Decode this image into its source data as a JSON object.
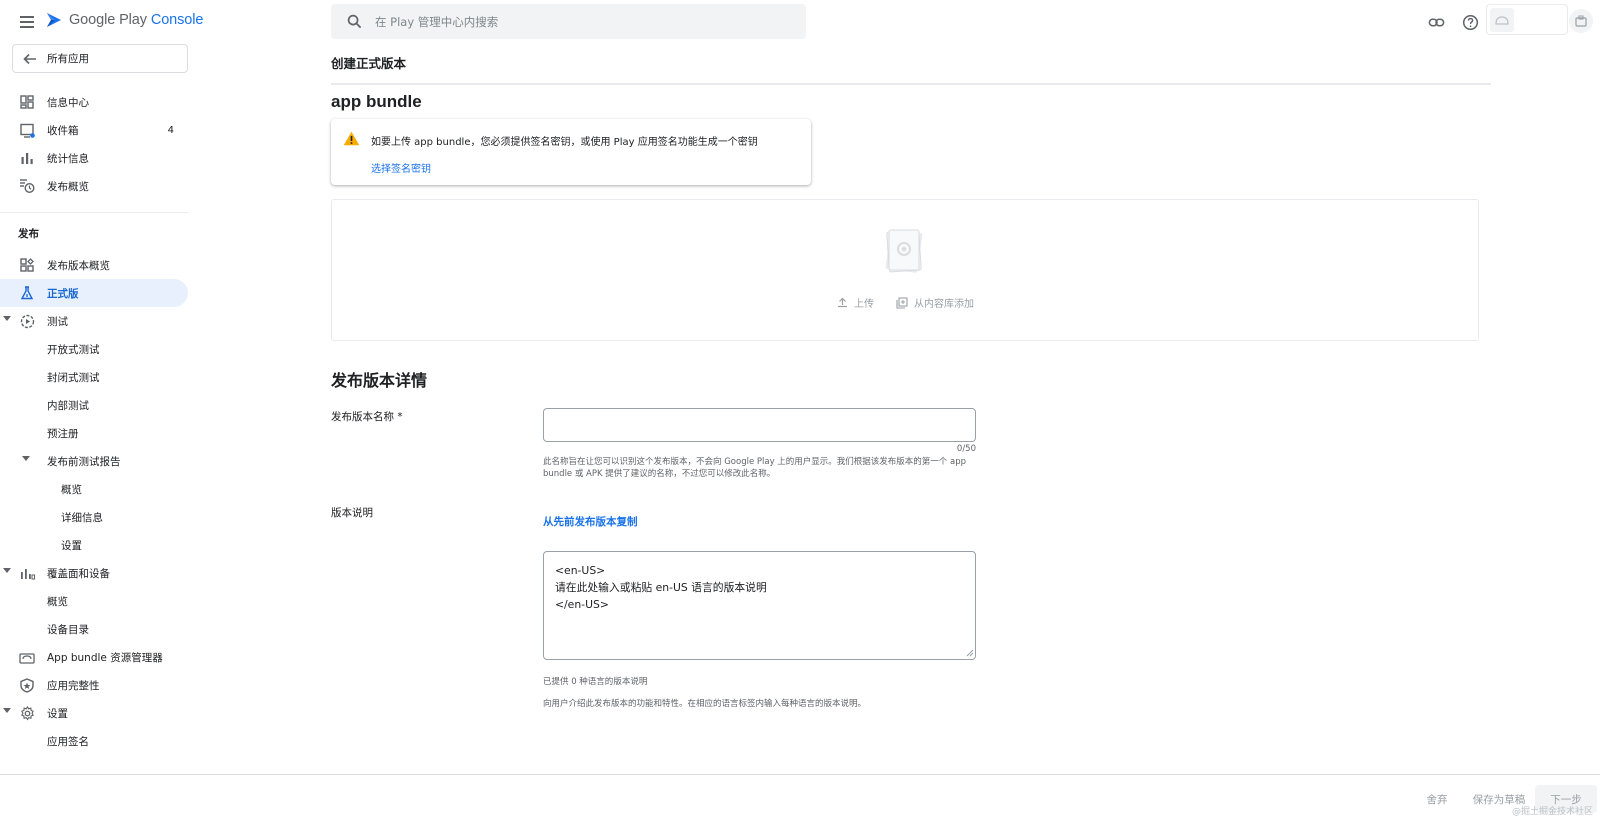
{
  "topbar": {
    "logo_word": "Google Play",
    "logo_suffix": "Console",
    "search_placeholder": "在 Play 管理中心内搜索",
    "icons": [
      "menu-icon",
      "search-icon",
      "link-icon",
      "help-icon",
      "android-icon",
      "account-icon"
    ]
  },
  "sidebar": {
    "back_label": "所有应用",
    "items_top": [
      {
        "label": "信息中心",
        "icon": "dashboard-icon"
      },
      {
        "label": "收件箱",
        "icon": "inbox-icon",
        "count": "4"
      },
      {
        "label": "统计信息",
        "icon": "bar-chart-icon"
      },
      {
        "label": "发布概览",
        "icon": "publishing-overview-icon"
      }
    ],
    "section_release": "发布",
    "items_release": [
      {
        "label": "发布版本概览",
        "icon": "releases-overview-icon"
      },
      {
        "label": "正式版",
        "icon": "production-icon",
        "active": true
      },
      {
        "label": "测试",
        "icon": "testing-icon"
      },
      {
        "label": "开放式测试"
      },
      {
        "label": "封闭式测试"
      },
      {
        "label": "内部测试"
      },
      {
        "label": "预注册"
      },
      {
        "label": "发布前测试报告"
      },
      {
        "label": "概览"
      },
      {
        "label": "详细信息"
      },
      {
        "label": "设置"
      },
      {
        "label": "覆盖面和设备",
        "icon": "reach-devices-icon"
      },
      {
        "label": "概览"
      },
      {
        "label": "设备目录"
      },
      {
        "label": "App bundle 资源管理器",
        "icon": "app-bundle-explorer-icon"
      },
      {
        "label": "应用完整性",
        "icon": "app-integrity-icon"
      },
      {
        "label": "设置",
        "icon": "settings-icon"
      },
      {
        "label": "应用签名"
      }
    ]
  },
  "main": {
    "page_title": "创建正式版本",
    "bundle_heading": "app bundle",
    "warning_text": "如要上传 app bundle，您必须提供签名密钥，或使用 Play 应用签名功能生成一个密钥",
    "warning_link": "选择签名密钥",
    "upload_label": "上传",
    "library_label": "从内容库添加",
    "details_heading": "发布版本详情",
    "release_name_label": "发布版本名称 *",
    "release_name_value": "",
    "release_name_counter": "0/50",
    "release_name_helper": "此名称旨在让您可以识别这个发布版本，不会向 Google Play 上的用户显示。我们根据该发布版本的第一个 app bundle 或 APK 提供了建议的名称，不过您可以修改此名称。",
    "notes_label": "版本说明",
    "copy_link": "从先前发布版本复制",
    "notes_value": "<en-US>\n请在此处输入或粘贴 en-US 语言的版本说明\n</en-US>",
    "notes_count": "已提供 0 种语言的版本说明",
    "notes_help": "向用户介绍此发布版本的功能和特性。在相应的语言标签内输入每种语言的版本说明。"
  },
  "footer": {
    "discard": "舍弃",
    "save_draft": "保存为草稿",
    "next": "下一步",
    "watermark": "@掘土掘金技术社区"
  },
  "colors": {
    "accent": "#1a73e8",
    "active_bg": "#e8f0fe",
    "warning": "#f9ab00"
  }
}
